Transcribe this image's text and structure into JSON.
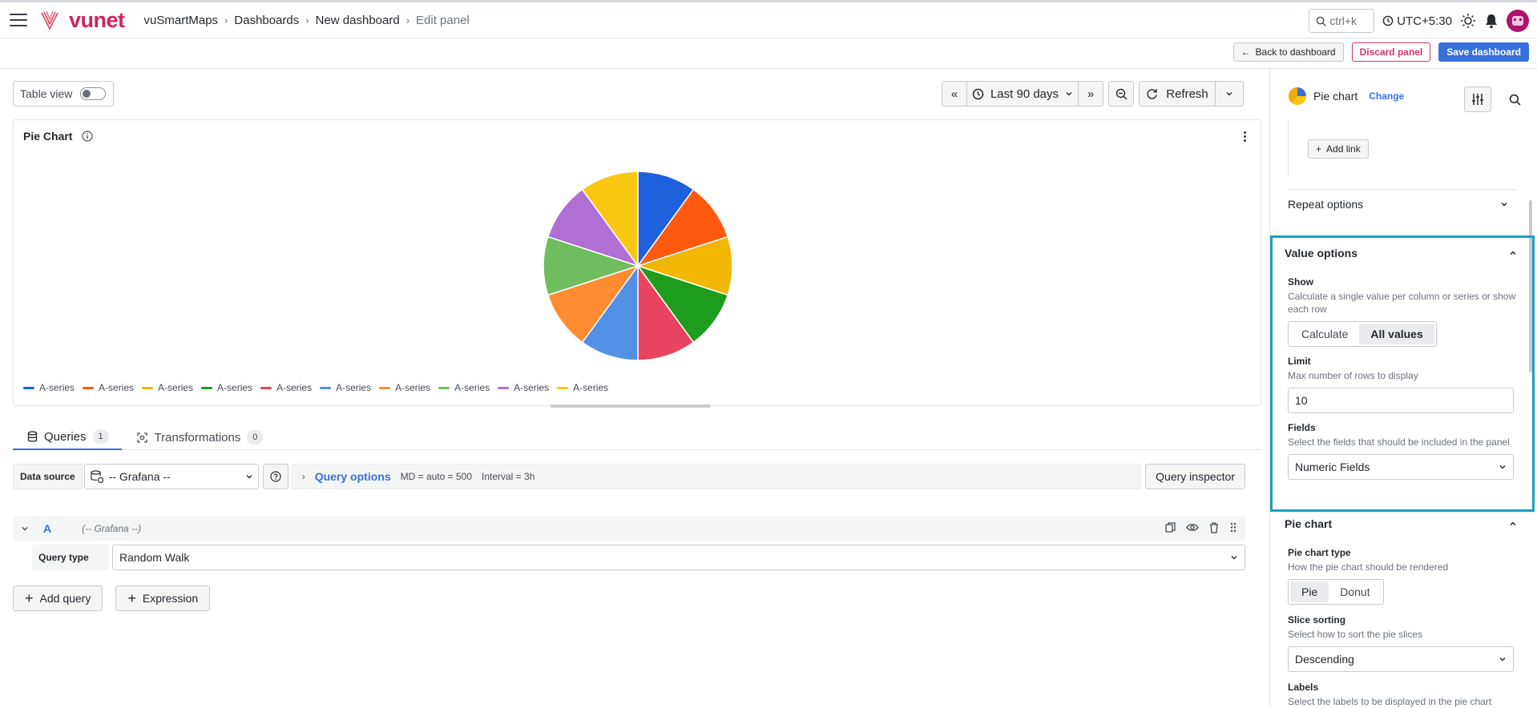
{
  "header": {
    "brand": "vunet",
    "breadcrumbs": [
      "vuSmartMaps",
      "Dashboards",
      "New dashboard",
      "Edit panel"
    ],
    "search_hint": "ctrl+k",
    "timezone": "UTC+5:30"
  },
  "toolbar": {
    "back_label": "Back to dashboard",
    "discard_label": "Discard panel",
    "save_label": "Save dashboard"
  },
  "panel_toolbar": {
    "table_view_label": "Table view",
    "time_range": "Last 90 days",
    "refresh_label": "Refresh"
  },
  "panel": {
    "title": "Pie Chart"
  },
  "chart_data": {
    "type": "pie",
    "categories": [
      "A-series",
      "A-series",
      "A-series",
      "A-series",
      "A-series",
      "A-series",
      "A-series",
      "A-series",
      "A-series",
      "A-series"
    ],
    "values": [
      1,
      1,
      1,
      1,
      1,
      1,
      1,
      1,
      1,
      1
    ],
    "colors": [
      "#1f60dd",
      "#fe5a0e",
      "#f2b705",
      "#1e9c1e",
      "#e8445f",
      "#5291e6",
      "#ff8c32",
      "#6fbd5f",
      "#b16fd6",
      "#fac812"
    ],
    "legend_placement": "bottom-left"
  },
  "query_tabs": [
    {
      "label": "Queries",
      "count": "1"
    },
    {
      "label": "Transformations",
      "count": "0"
    }
  ],
  "datasource": {
    "label": "Data source",
    "value": "-- Grafana --",
    "query_options_label": "Query options",
    "md": "MD = auto = 500",
    "interval": "Interval = 3h",
    "inspector_label": "Query inspector"
  },
  "query": {
    "ref": "A",
    "datasource": "(-- Grafana --)",
    "type_label": "Query type",
    "type_value": "Random Walk"
  },
  "buttons": {
    "add_query": "Add query",
    "expression": "Expression"
  },
  "options": {
    "viz_name": "Pie chart",
    "change_label": "Change",
    "add_link": "Add link",
    "repeat_options": "Repeat options",
    "value_options": {
      "title": "Value options",
      "show_title": "Show",
      "show_desc": "Calculate a single value per column or series or show each row",
      "show_choices": [
        "Calculate",
        "All values"
      ],
      "limit_title": "Limit",
      "limit_desc": "Max number of rows to display",
      "limit_value": "10",
      "fields_title": "Fields",
      "fields_desc": "Select the fields that should be included in the panel",
      "fields_value": "Numeric Fields"
    },
    "pie_chart": {
      "title": "Pie chart",
      "type_title": "Pie chart type",
      "type_desc": "How the pie chart should be rendered",
      "type_choices": [
        "Pie",
        "Donut"
      ],
      "sort_title": "Slice sorting",
      "sort_desc": "Select how to sort the pie slices",
      "sort_value": "Descending",
      "labels_title": "Labels",
      "labels_desc": "Select the labels to be displayed in the pie chart"
    }
  }
}
